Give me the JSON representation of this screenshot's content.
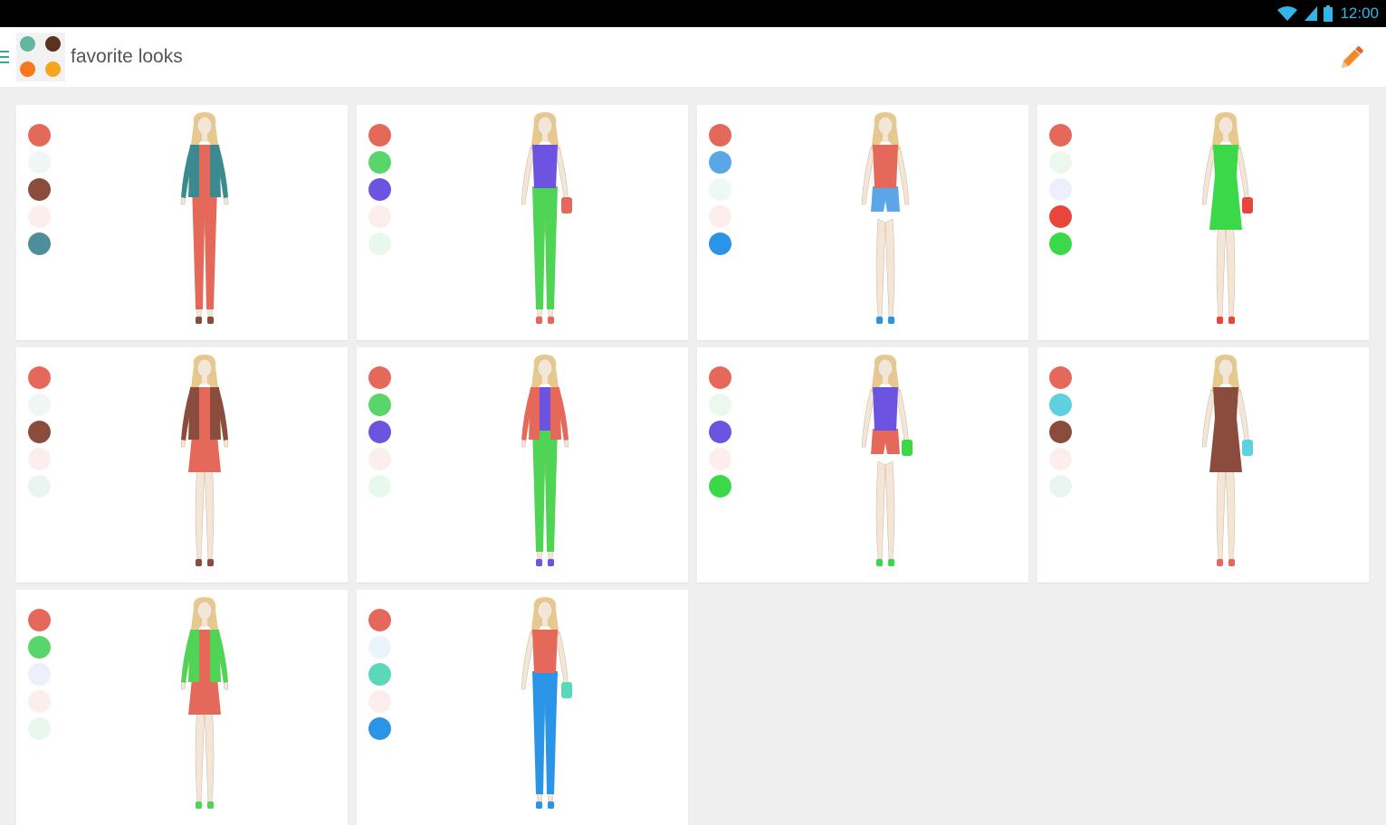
{
  "status_bar": {
    "time": "12:00",
    "icons": [
      "wifi-icon",
      "signal-icon",
      "battery-icon"
    ]
  },
  "action_bar": {
    "title": "favorite looks",
    "logo_dot_colors": [
      "#63b79f",
      "#5a3320",
      "#f5781d",
      "#f8a51e"
    ],
    "edit_icon": "pencil-icon",
    "edit_color": "#f07b22"
  },
  "looks": [
    {
      "palette": [
        "#e5695b",
        "#eef7f6",
        "#8a4c3d",
        "#fdeeee",
        "#4e8d9a"
      ],
      "outfit": {
        "top": "#e5695b",
        "bottom": "#e5695b",
        "jacket": "#3a8a8f",
        "shoes": "#8a4c3d",
        "accessory": null,
        "dress": false
      }
    },
    {
      "palette": [
        "#e5695b",
        "#5ad56c",
        "#6d54e0",
        "#fdeeee",
        "#e9f8ec"
      ],
      "outfit": {
        "top": "#6d54e0",
        "bottom": "#4fd456",
        "jacket": null,
        "shoes": "#e5695b",
        "accessory": "#e5695b",
        "dress": false
      }
    },
    {
      "palette": [
        "#e5695b",
        "#5aa6e6",
        "#eef8f4",
        "#fdeeee",
        "#2a94e6"
      ],
      "outfit": {
        "top": "#e5695b",
        "bottom": "#5aa6e6",
        "jacket": null,
        "shoes": "#2a94e6",
        "accessory": null,
        "dress": false,
        "shorts": true
      }
    },
    {
      "palette": [
        "#e5695b",
        "#ecf8ee",
        "#eeeefc",
        "#e8453c",
        "#3bd84a"
      ],
      "outfit": {
        "top": "#3bd84a",
        "bottom": "#3bd84a",
        "jacket": null,
        "shoes": "#e8453c",
        "accessory": "#e8453c",
        "dress": true
      }
    },
    {
      "palette": [
        "#e5695b",
        "#eef7f6",
        "#8a4c3d",
        "#fdeeee",
        "#eaf5ef"
      ],
      "outfit": {
        "top": "#e5695b",
        "bottom": "#e5695b",
        "jacket": "#8a4c3d",
        "shoes": "#8a4c3d",
        "accessory": null,
        "dress": true
      }
    },
    {
      "palette": [
        "#e5695b",
        "#5ad56c",
        "#6d54e0",
        "#fdeeee",
        "#e9f8ec"
      ],
      "outfit": {
        "top": "#6d54e0",
        "bottom": "#4fd456",
        "jacket": "#e5695b",
        "shoes": "#6d54e0",
        "accessory": null,
        "dress": false
      }
    },
    {
      "palette": [
        "#e5695b",
        "#ecf8ee",
        "#6d54e0",
        "#fdeeee",
        "#3bd84a"
      ],
      "outfit": {
        "top": "#6d54e0",
        "bottom": "#e5695b",
        "jacket": null,
        "shoes": "#3bd84a",
        "accessory": "#3bd84a",
        "dress": false,
        "shorts": true
      }
    },
    {
      "palette": [
        "#e5695b",
        "#5fd0df",
        "#8a4c3d",
        "#fdeeee",
        "#eaf5ef"
      ],
      "outfit": {
        "top": "#8a4c3d",
        "bottom": "#8a4c3d",
        "jacket": null,
        "shoes": "#e5695b",
        "accessory": "#5fd0df",
        "dress": true
      }
    },
    {
      "palette": [
        "#e5695b",
        "#5ad56c",
        "#eeeefc",
        "#fdeeee",
        "#e9f8ec"
      ],
      "outfit": {
        "top": "#e5695b",
        "bottom": "#e5695b",
        "jacket": "#4fd456",
        "shoes": "#4fd456",
        "accessory": null,
        "dress": true
      }
    },
    {
      "palette": [
        "#e5695b",
        "#eaf4fb",
        "#5ad8b8",
        "#fdeeee",
        "#2a94e6"
      ],
      "outfit": {
        "top": "#e5695b",
        "bottom": "#2a94e6",
        "jacket": null,
        "shoes": "#2a94e6",
        "accessory": "#5ad8b8",
        "dress": false
      }
    }
  ]
}
